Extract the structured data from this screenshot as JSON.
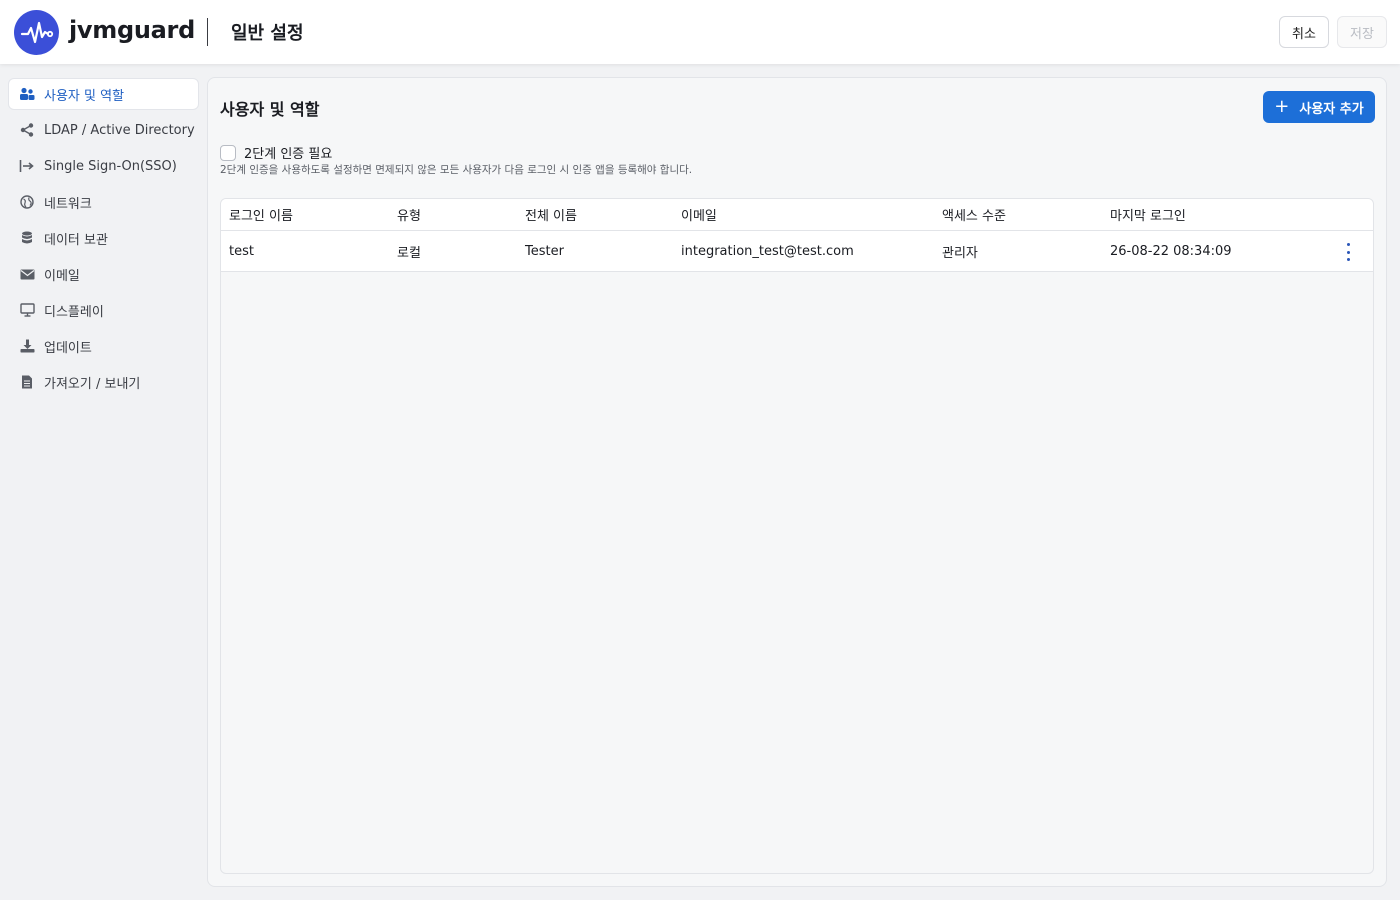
{
  "app": {
    "brand": "jvmguard",
    "page_title": "일반 설정",
    "accent": "#1d6fd8",
    "logo_color": "#3b4fd8"
  },
  "header": {
    "cancel_label": "취소",
    "save_label": "저장"
  },
  "sidebar": {
    "items": [
      {
        "label": "사용자 및 역할",
        "icon": "users-icon",
        "active": true
      },
      {
        "label": "LDAP / Active Directory",
        "icon": "share-icon"
      },
      {
        "label": "Single Sign-On(SSO)",
        "icon": "sign-in-icon"
      },
      {
        "label": "네트워크",
        "icon": "globe-icon"
      },
      {
        "label": "데이터 보관",
        "icon": "database-icon"
      },
      {
        "label": "이메일",
        "icon": "envelope-icon"
      },
      {
        "label": "디스플레이",
        "icon": "monitor-icon"
      },
      {
        "label": "업데이트",
        "icon": "download-icon"
      },
      {
        "label": "가져오기 / 보내기",
        "icon": "file-icon"
      }
    ]
  },
  "main": {
    "title": "사용자 및 역할",
    "add_user_label": "사용자 추가",
    "two_factor": {
      "label": "2단계 인증 필요",
      "description": "2단계 인증을 사용하도록 설정하면 면제되지 않은 모든 사용자가 다음 로그인 시 인증 앱을 등록해야 합니다.",
      "checked": false
    },
    "table": {
      "columns": [
        "로그인 이름",
        "유형",
        "전체 이름",
        "이메일",
        "액세스 수준",
        "마지막 로그인"
      ],
      "rows": [
        [
          "test",
          "로컬",
          "Tester",
          "integration_test@test.com",
          "관리자",
          "26-08-22 08:34:09"
        ]
      ]
    }
  }
}
